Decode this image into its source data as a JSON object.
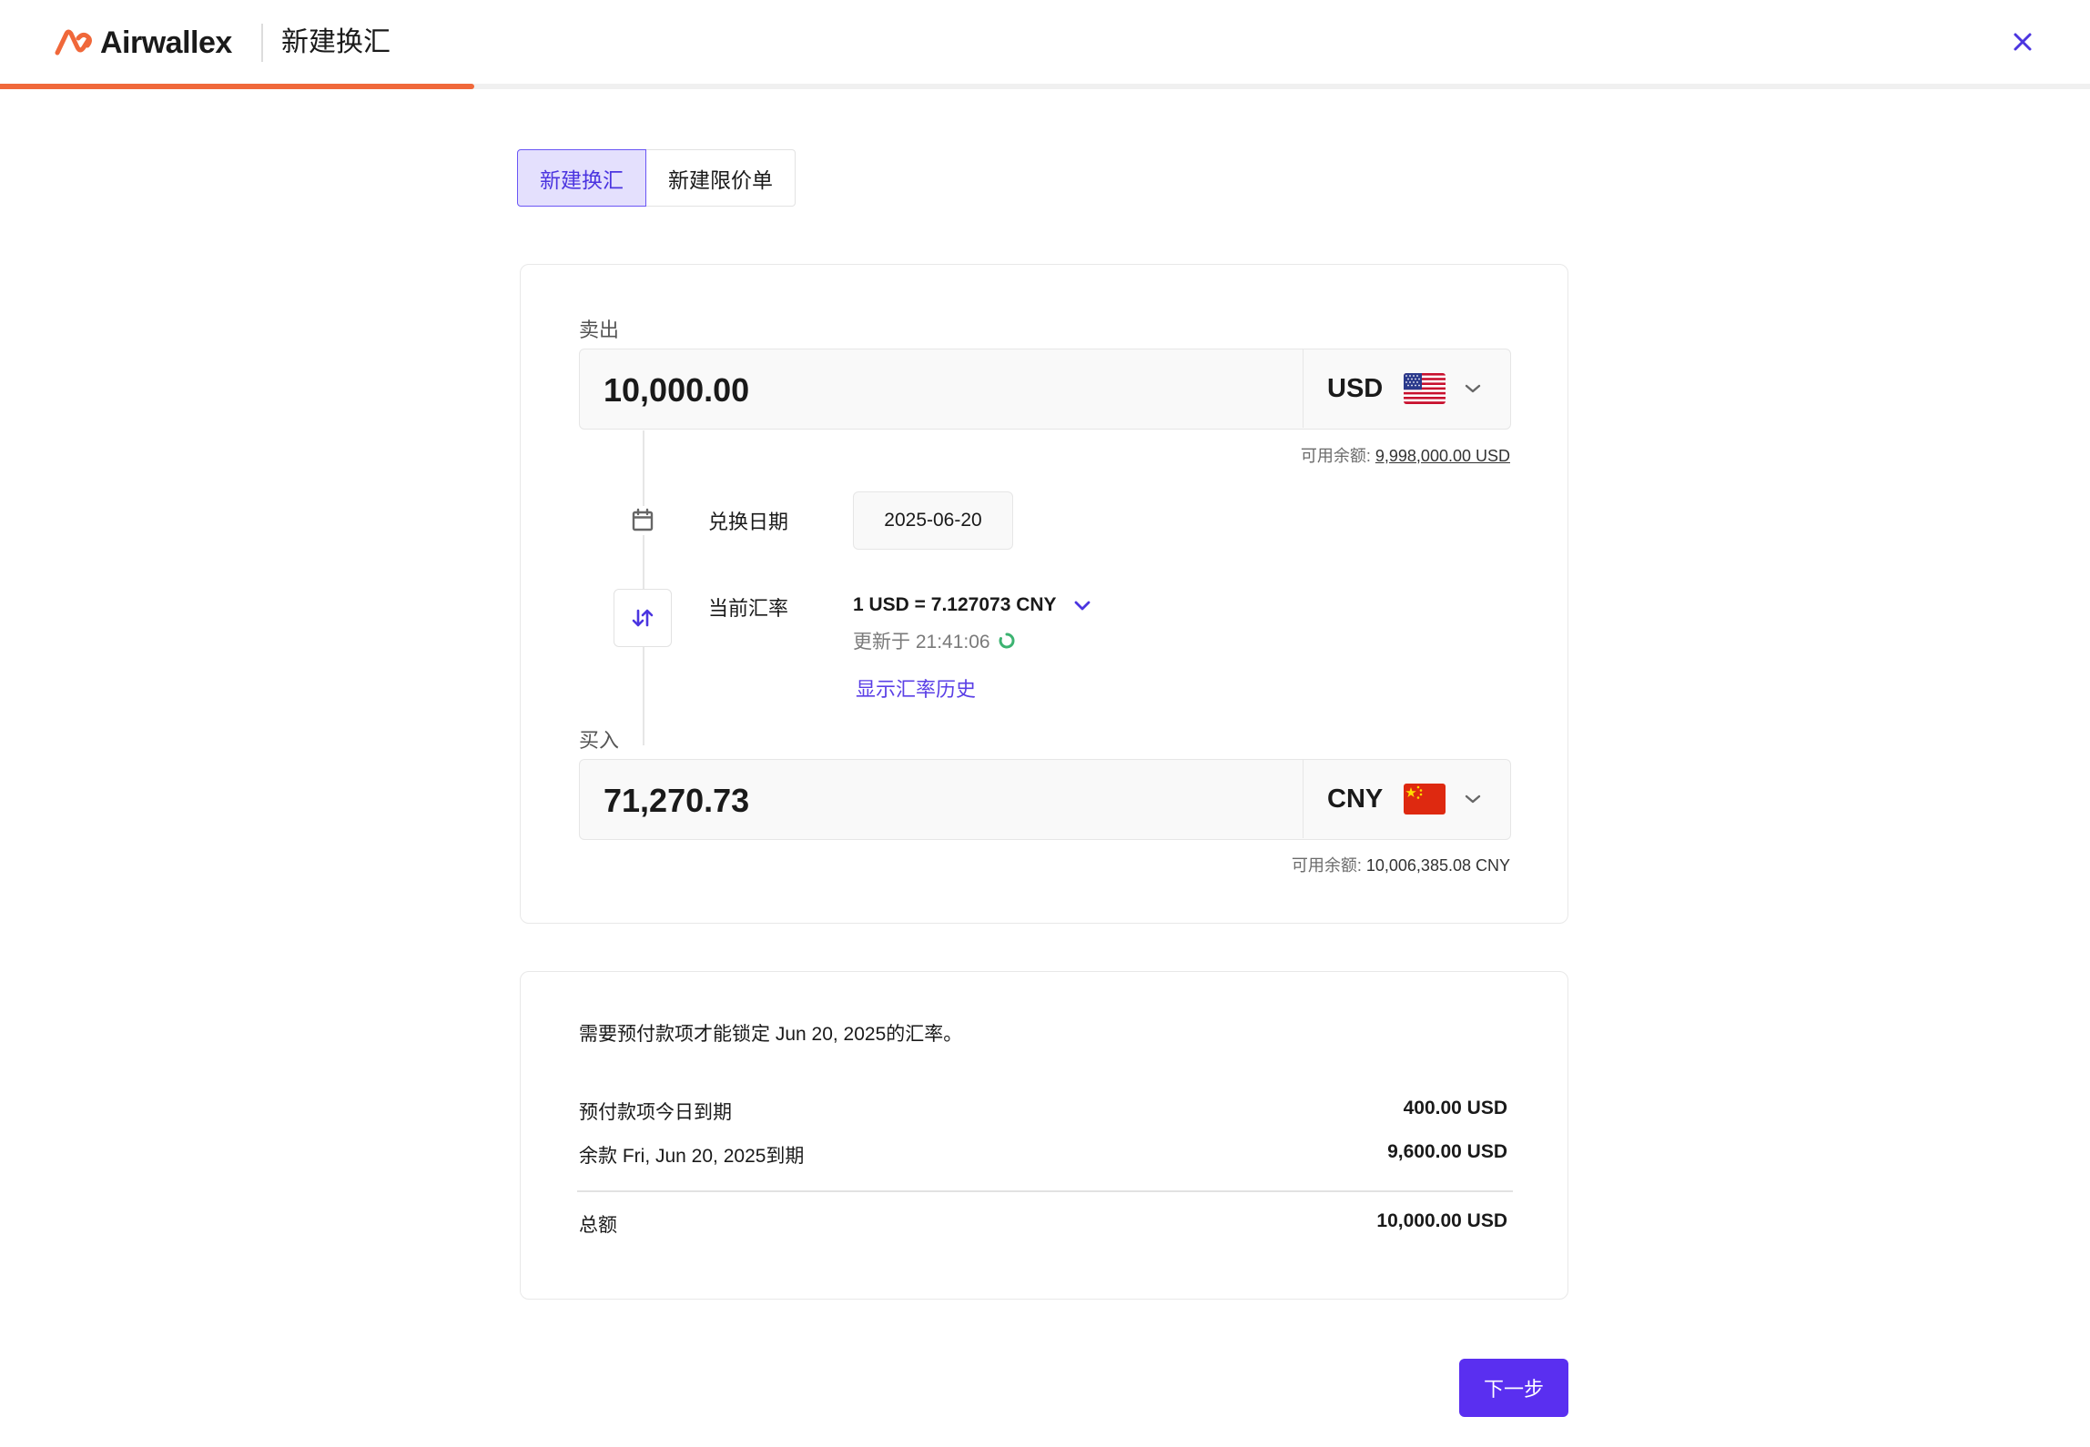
{
  "header": {
    "brand": "Airwallex",
    "title": "新建换汇",
    "progress_fraction": 0.227
  },
  "tabs": [
    {
      "label": "新建换汇",
      "active": true
    },
    {
      "label": "新建限价单",
      "active": false
    }
  ],
  "sell": {
    "label": "卖出",
    "amount": "10,000.00",
    "currency": "USD",
    "flag_icon": "us-flag-icon",
    "balance_label": "可用余额:",
    "balance_value": "9,998,000.00 USD"
  },
  "conversion_date": {
    "label": "兑换日期",
    "value": "2025-06-20"
  },
  "rate": {
    "label": "当前汇率",
    "value": "1 USD = 7.127073 CNY",
    "updated": "更新于 21:41:06",
    "history_link": "显示汇率历史"
  },
  "buy": {
    "label": "买入",
    "amount": "71,270.73",
    "currency": "CNY",
    "flag_icon": "cn-flag-icon",
    "balance_label": "可用余额:",
    "balance_value": "10,006,385.08 CNY"
  },
  "summary": {
    "notice": "需要预付款项才能锁定 Jun 20, 2025的汇率。",
    "rows": [
      {
        "label": "预付款项今日到期",
        "value": "400.00 USD"
      },
      {
        "label": "余款 Fri, Jun 20, 2025到期",
        "value": "9,600.00 USD"
      }
    ],
    "total_label": "总额",
    "total_value": "10,000.00 USD"
  },
  "next_button": "下一步",
  "colors": {
    "accent": "#5a2ff0",
    "brand_orange": "#f0683a",
    "link": "#5a3fe6",
    "refresh_green": "#3cb371"
  }
}
